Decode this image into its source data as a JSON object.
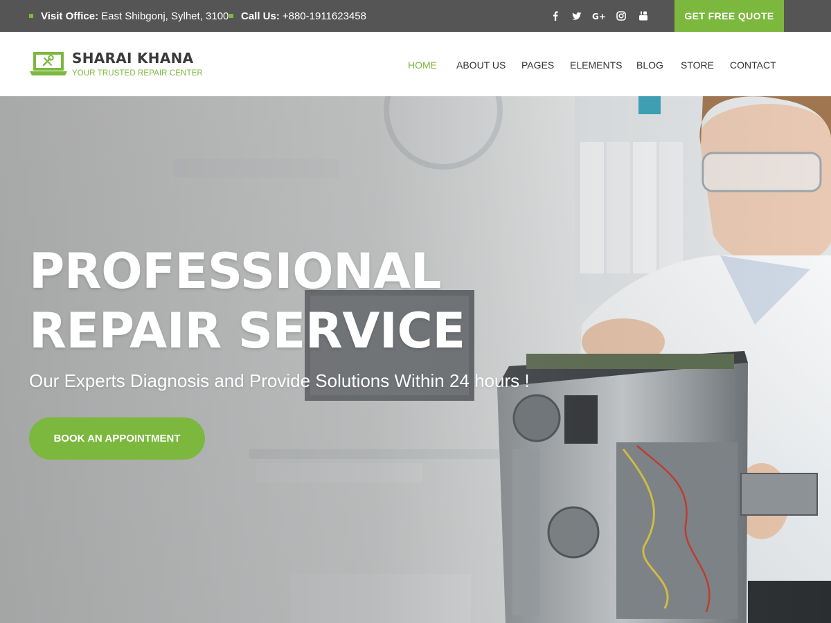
{
  "topbar": {
    "office_label": "Visit Office:",
    "office_value": "East Shibgonj, Sylhet, 3100",
    "phone_label": "Call Us:",
    "phone_value": "+880-1911623458",
    "social": [
      "facebook-icon",
      "twitter-icon",
      "google-plus-icon",
      "instagram-icon",
      "youtube-icon"
    ],
    "quote_button": "GET FREE QUOTE"
  },
  "header": {
    "logo_name": "SHARAI KHANA",
    "logo_tagline": "YOUR TRUSTED REPAIR CENTER",
    "nav": [
      {
        "label": "HOME",
        "active": true
      },
      {
        "label": "ABOUT US",
        "active": false
      },
      {
        "label": "PAGES",
        "active": false
      },
      {
        "label": "ELEMENTS",
        "active": false
      },
      {
        "label": "BLOG",
        "active": false
      },
      {
        "label": "STORE",
        "active": false
      },
      {
        "label": "CONTACT",
        "active": false
      }
    ]
  },
  "hero": {
    "title_line1": "PROFESSIONAL",
    "title_line2": "REPAIR SERVICE",
    "subtitle": "Our Experts Diagnosis and Provide Solutions Within 24 hours !",
    "button": "BOOK AN APPOINTMENT"
  },
  "colors": {
    "accent": "#7cb83e",
    "topbar_bg": "#555555",
    "nav_text": "#333333"
  }
}
